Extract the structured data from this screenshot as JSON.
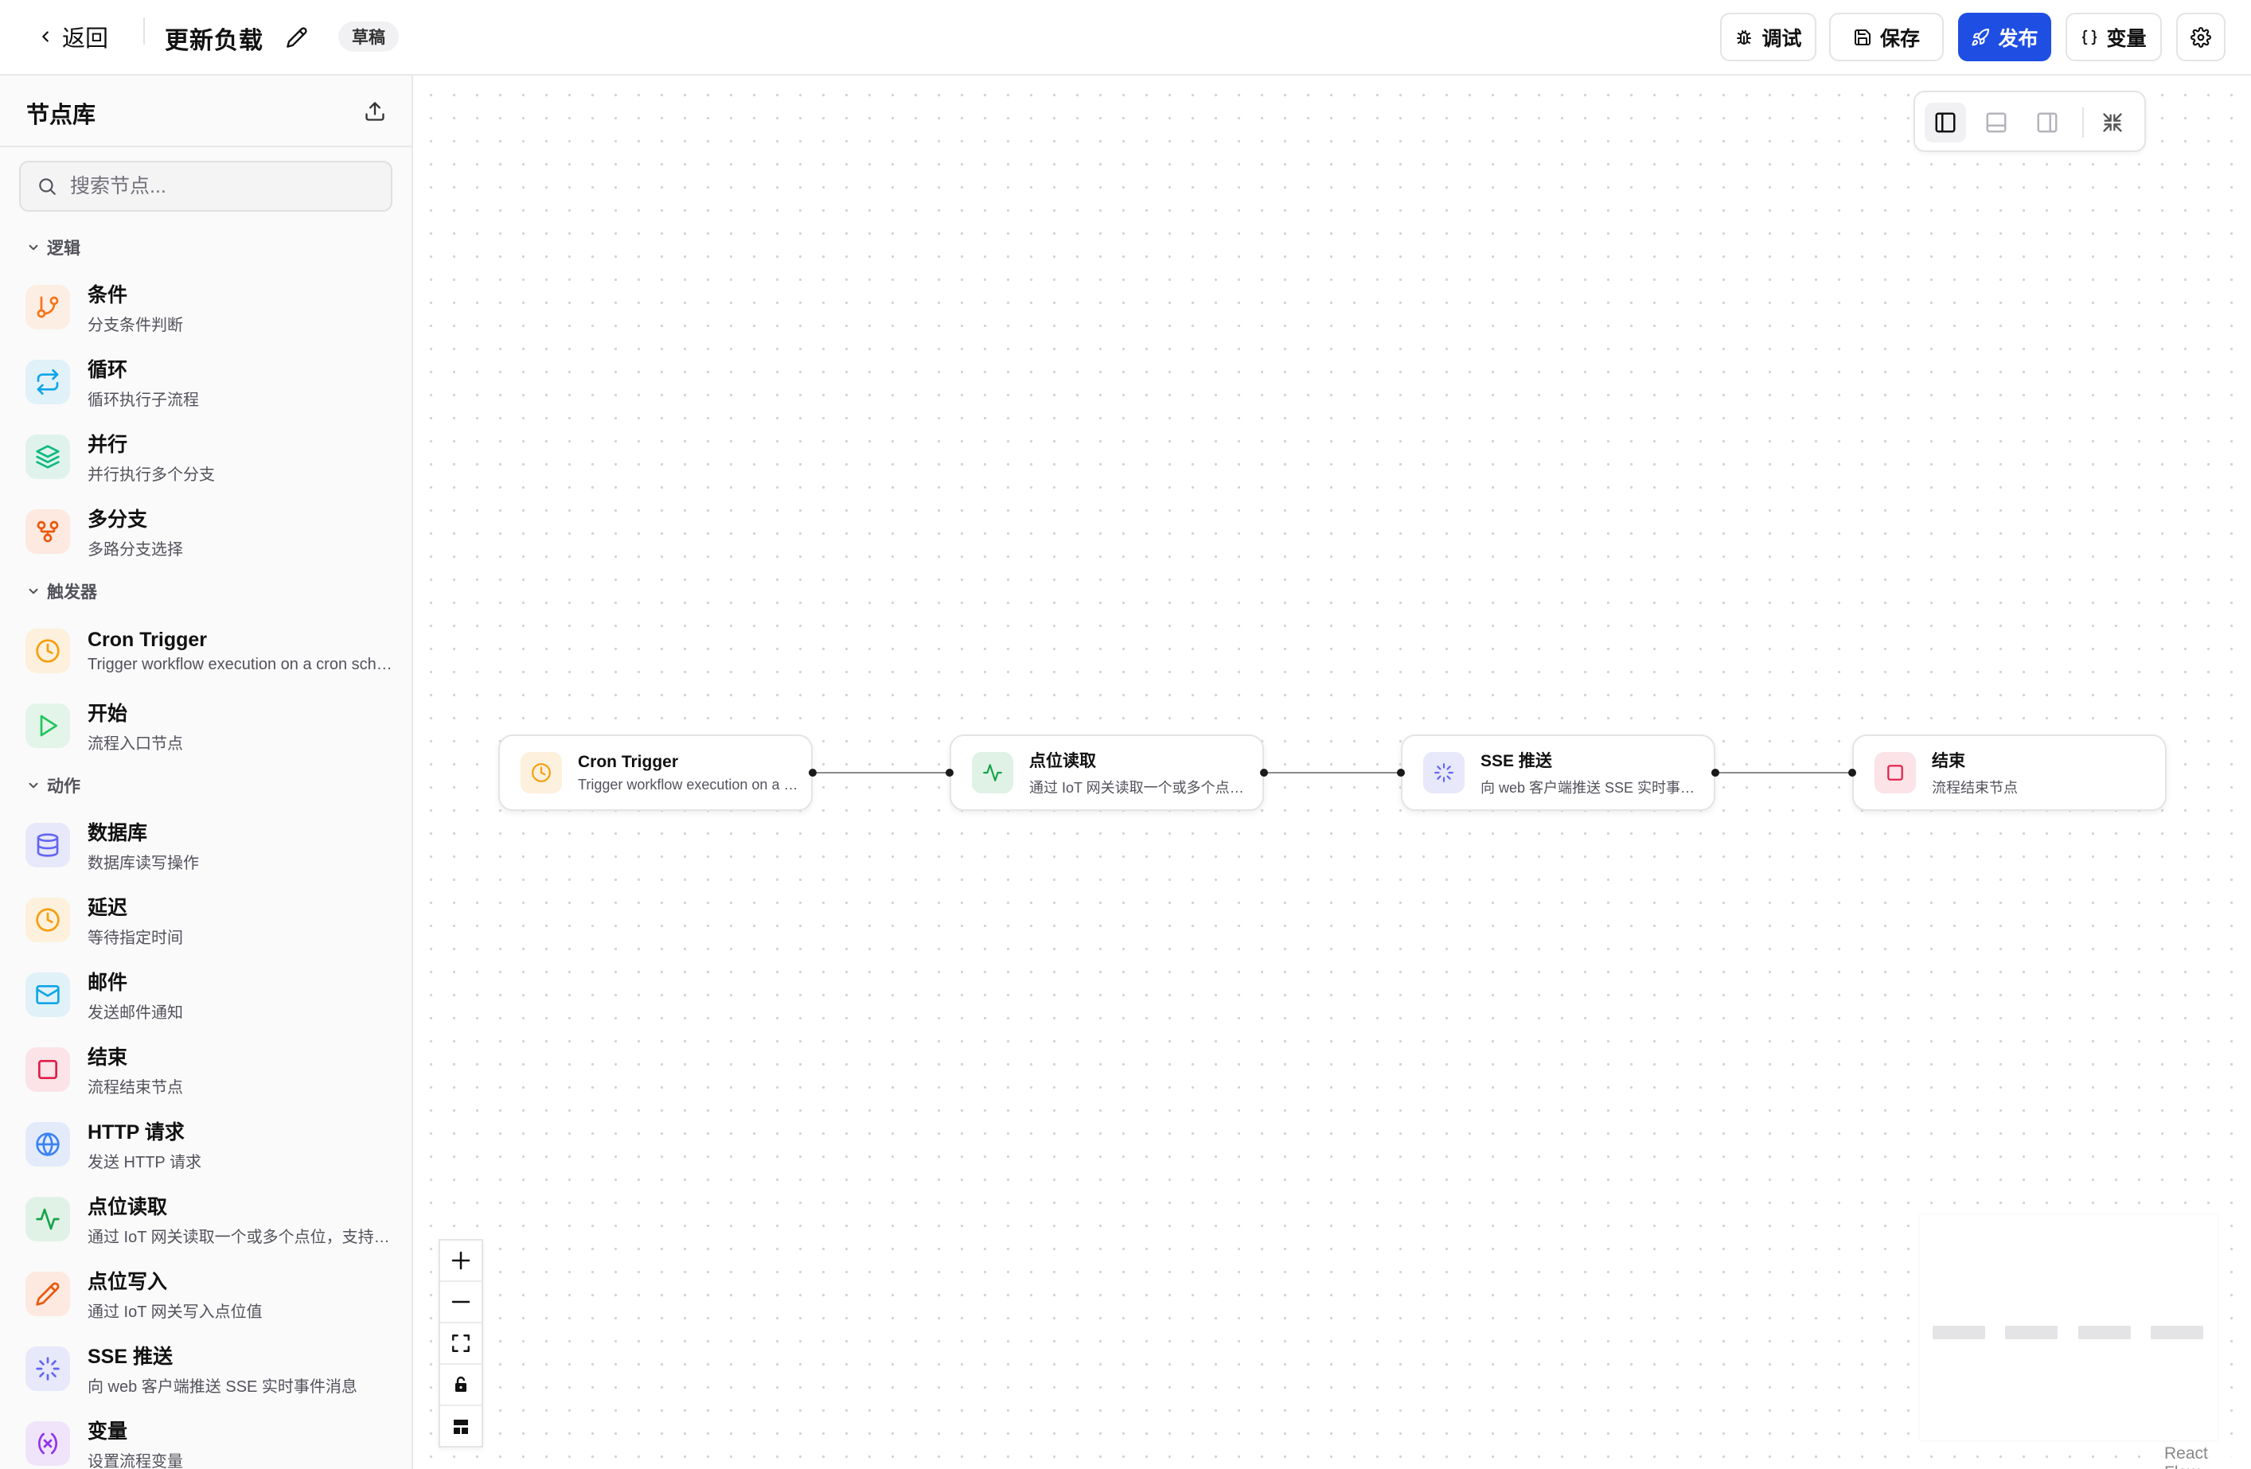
{
  "topbar": {
    "back_label": "返回",
    "title": "更新负载",
    "status_badge": "草稿",
    "buttons": {
      "debug": "调试",
      "save": "保存",
      "publish": "发布",
      "variables": "变量"
    }
  },
  "sidebar": {
    "title": "节点库",
    "search_placeholder": "搜索节点...",
    "sections": [
      {
        "label": "逻辑",
        "items": [
          {
            "name": "条件",
            "desc": "分支条件判断",
            "icon": "git-branch-icon",
            "color": "#f97316",
            "bg": "#fdeee3"
          },
          {
            "name": "循环",
            "desc": "循环执行子流程",
            "icon": "repeat-icon",
            "color": "#0ea5e9",
            "bg": "#e0f1f8"
          },
          {
            "name": "并行",
            "desc": "并行执行多个分支",
            "icon": "layers-icon",
            "color": "#10b981",
            "bg": "#dff3ec"
          },
          {
            "name": "多分支",
            "desc": "多路分支选择",
            "icon": "git-fork-icon",
            "color": "#ea580c",
            "bg": "#fde9df"
          }
        ]
      },
      {
        "label": "触发器",
        "items": [
          {
            "name": "Cron Trigger",
            "desc": "Trigger workflow execution on a cron schedule",
            "icon": "clock-icon",
            "color": "#f59e0b",
            "bg": "#fdf0dc"
          },
          {
            "name": "开始",
            "desc": "流程入口节点",
            "icon": "play-icon",
            "color": "#22c55e",
            "bg": "#e3f4e8"
          }
        ]
      },
      {
        "label": "动作",
        "items": [
          {
            "name": "数据库",
            "desc": "数据库读写操作",
            "icon": "database-icon",
            "color": "#6366f1",
            "bg": "#e7e8fa"
          },
          {
            "name": "延迟",
            "desc": "等待指定时间",
            "icon": "clock-icon",
            "color": "#f59e0b",
            "bg": "#fdf0dc"
          },
          {
            "name": "邮件",
            "desc": "发送邮件通知",
            "icon": "mail-icon",
            "color": "#0ea5e9",
            "bg": "#e0f1f8"
          },
          {
            "name": "结束",
            "desc": "流程结束节点",
            "icon": "square-icon",
            "color": "#e11d48",
            "bg": "#fbe3e7"
          },
          {
            "name": "HTTP 请求",
            "desc": "发送 HTTP 请求",
            "icon": "globe-icon",
            "color": "#3b82f6",
            "bg": "#e3ebfb"
          },
          {
            "name": "点位读取",
            "desc": "通过 IoT 网关读取一个或多个点位，支持批量读取",
            "icon": "activity-icon",
            "color": "#16a34a",
            "bg": "#e0f2e6"
          },
          {
            "name": "点位写入",
            "desc": "通过 IoT 网关写入点位值",
            "icon": "pencil-icon",
            "color": "#ea580c",
            "bg": "#fde9df"
          },
          {
            "name": "SSE 推送",
            "desc": "向 web 客户端推送 SSE 实时事件消息",
            "icon": "loader-icon",
            "color": "#6366f1",
            "bg": "#e7e8fa"
          },
          {
            "name": "变量",
            "desc": "设置流程变量",
            "icon": "variable-icon",
            "color": "#9333ea",
            "bg": "#efe4fa"
          }
        ]
      }
    ]
  },
  "canvas": {
    "nodes": [
      {
        "name": "Cron Trigger",
        "desc": "Trigger workflow execution on a cron schedule",
        "icon": "clock-icon",
        "color": "#f59e0b",
        "bg": "#fdf0dc"
      },
      {
        "name": "点位读取",
        "desc": "通过 IoT 网关读取一个或多个点位，支持批量读取",
        "icon": "activity-icon",
        "color": "#16a34a",
        "bg": "#e0f2e6"
      },
      {
        "name": "SSE 推送",
        "desc": "向 web 客户端推送 SSE 实时事件消息",
        "icon": "loader-icon",
        "color": "#6366f1",
        "bg": "#e7e8fa"
      },
      {
        "name": "结束",
        "desc": "流程结束节点",
        "icon": "square-icon",
        "color": "#e11d48",
        "bg": "#fbe3e7"
      }
    ],
    "attribution": "React Flow"
  }
}
